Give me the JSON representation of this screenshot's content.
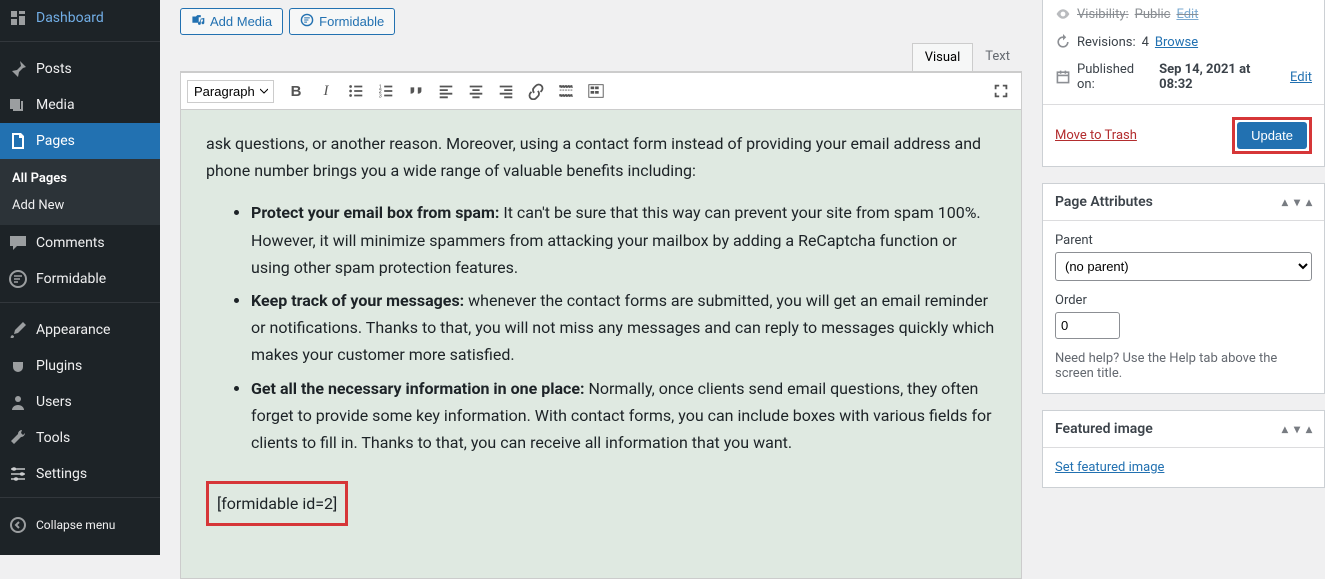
{
  "sidebar": {
    "items": [
      {
        "label": "Dashboard",
        "icon": "dashboard"
      },
      {
        "label": "Posts",
        "icon": "pin"
      },
      {
        "label": "Media",
        "icon": "media"
      },
      {
        "label": "Pages",
        "icon": "pages",
        "current": true
      },
      {
        "label": "Comments",
        "icon": "comment"
      },
      {
        "label": "Formidable",
        "icon": "formidable"
      },
      {
        "label": "Appearance",
        "icon": "brush"
      },
      {
        "label": "Plugins",
        "icon": "plug"
      },
      {
        "label": "Users",
        "icon": "user"
      },
      {
        "label": "Tools",
        "icon": "wrench"
      },
      {
        "label": "Settings",
        "icon": "sliders"
      },
      {
        "label": "Collapse menu",
        "icon": "collapse"
      }
    ],
    "sub": {
      "all": "All Pages",
      "add": "Add New"
    }
  },
  "mediaRow": {
    "addMedia": "Add Media",
    "formidable": "Formidable"
  },
  "tabs": {
    "visual": "Visual",
    "text": "Text"
  },
  "format": "Paragraph",
  "content": {
    "intro": "ask questions, or another reason. Moreover, using a contact form instead of providing your email address and phone number brings you a wide range of valuable benefits including:",
    "b1t": "Protect your email box from spam:",
    "b1": " It can't be sure that this way can prevent your site from spam 100%. However, it will minimize spammers from attacking your mailbox by adding a ReCaptcha function or using other spam protection features.",
    "b2t": "Keep track of your messages:",
    "b2": " whenever the contact forms are submitted, you will get an email reminder or notifications. Thanks to that, you will not miss any messages and can reply to messages quickly which makes your customer more satisfied.",
    "b3t": "Get all the necessary information in one place:",
    "b3": " Normally, once clients send email questions, they often forget to provide some key information. With contact forms, you can include boxes with various fields for clients to fill in. Thanks to that, you can receive all information that you want.",
    "shortcode": "[formidable id=2]"
  },
  "publish": {
    "visLabel": "Visibility:",
    "visValue": "Public",
    "visEdit": "Edit",
    "revLabel": "Revisions:",
    "revCount": "4",
    "revBrowse": "Browse",
    "pubLabel": "Published on:",
    "pubValue": "Sep 14, 2021 at 08:32",
    "pubEdit": "Edit",
    "trash": "Move to Trash",
    "update": "Update"
  },
  "attrs": {
    "title": "Page Attributes",
    "parentLabel": "Parent",
    "parentValue": "(no parent)",
    "orderLabel": "Order",
    "orderValue": "0",
    "help": "Need help? Use the Help tab above the screen title."
  },
  "featured": {
    "title": "Featured image",
    "link": "Set featured image"
  }
}
